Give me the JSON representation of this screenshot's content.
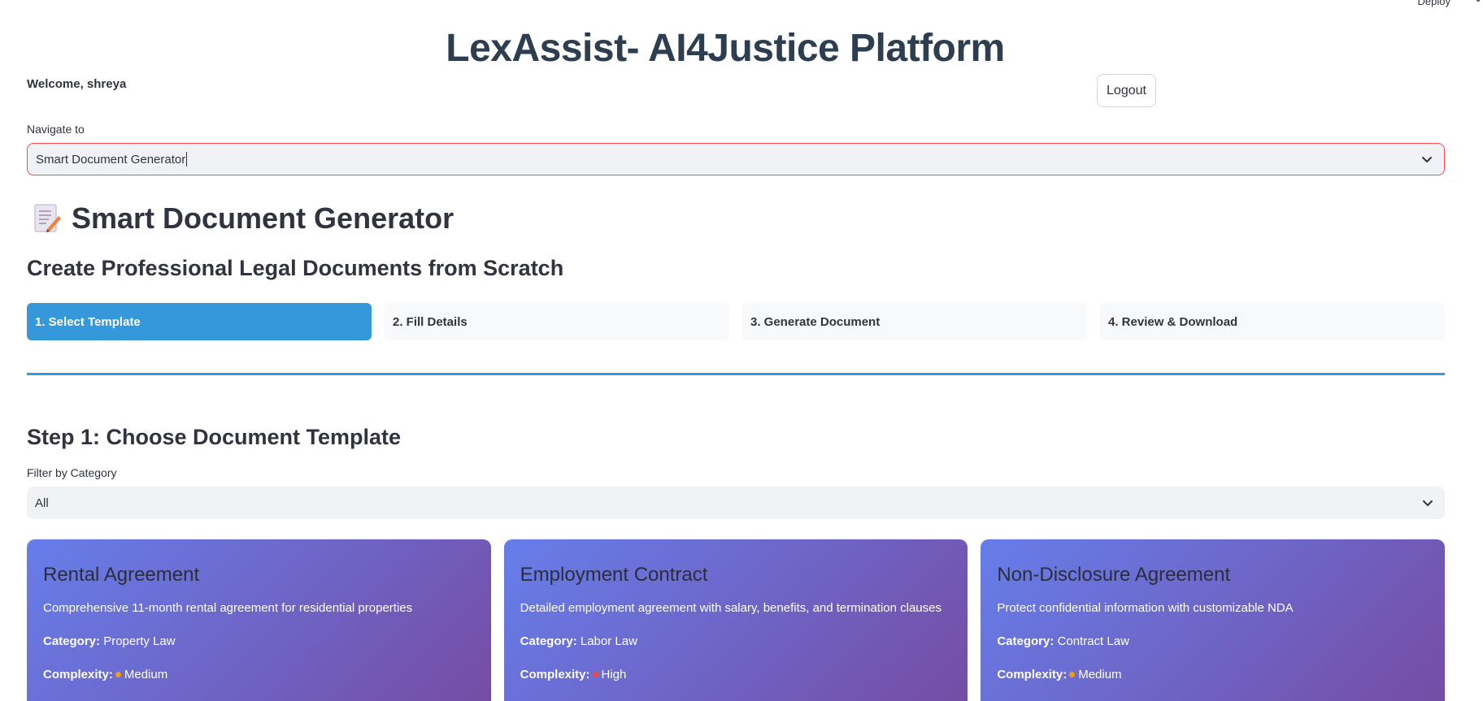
{
  "header": {
    "deploy_label": "Deploy",
    "app_title": "LexAssist- AI4Justice Platform",
    "welcome": "Welcome, shreya",
    "logout_label": "Logout"
  },
  "navigation": {
    "label": "Navigate to",
    "selected": "Smart Document Generator"
  },
  "page": {
    "title": "Smart Document Generator",
    "subtitle": "Create Professional Legal Documents from Scratch"
  },
  "steps": [
    {
      "label": "1. Select Template",
      "active": true
    },
    {
      "label": "2. Fill Details",
      "active": false
    },
    {
      "label": "3. Generate Document",
      "active": false
    },
    {
      "label": "4. Review & Download",
      "active": false
    }
  ],
  "step1": {
    "title": "Step 1: Choose Document Template",
    "filter_label": "Filter by Category",
    "filter_selected": "All"
  },
  "templates": [
    {
      "name": "Rental Agreement",
      "description": "Comprehensive 11-month rental agreement for residential properties",
      "category_label": "Category:",
      "category": "Property Law",
      "complexity_label": "Complexity:",
      "complexity": "Medium",
      "complexity_color": "#f39c12"
    },
    {
      "name": "Employment Contract",
      "description": "Detailed employment agreement with salary, benefits, and termination clauses",
      "category_label": "Category:",
      "category": "Labor Law",
      "complexity_label": "Complexity:",
      "complexity": "High",
      "complexity_color": "#e74c3c"
    },
    {
      "name": "Non-Disclosure Agreement",
      "description": "Protect confidential information with customizable NDA",
      "category_label": "Category:",
      "category": "Contract Law",
      "complexity_label": "Complexity:",
      "complexity": "Medium",
      "complexity_color": "#f39c12"
    }
  ],
  "colors": {
    "accent": "#3498db",
    "focus_border": "#ff4b4b",
    "card_gradient_start": "#667eea",
    "card_gradient_end": "#764ba2"
  }
}
